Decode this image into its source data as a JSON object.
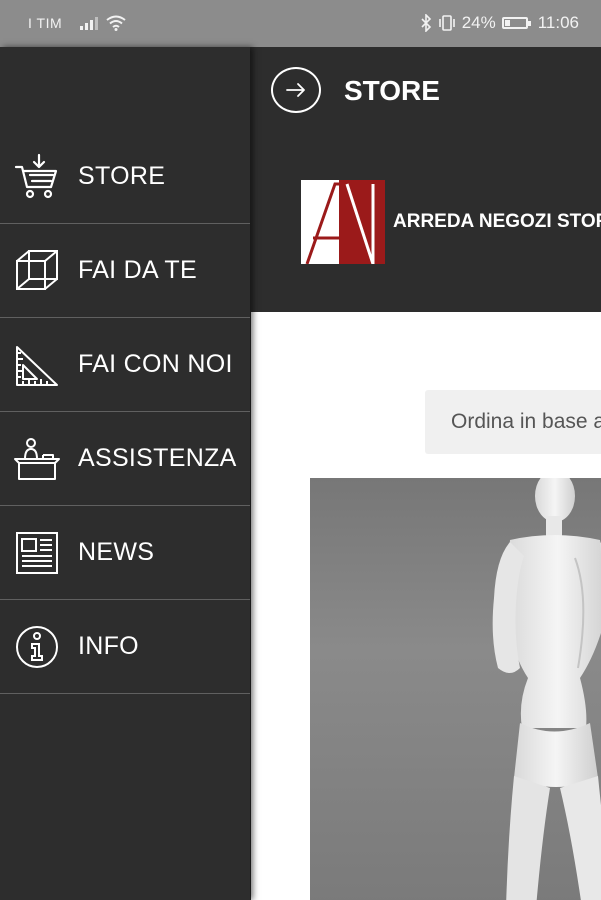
{
  "status_bar": {
    "carrier": "I TIM",
    "battery_percent": "24%",
    "battery_level": 0.24,
    "time": "11:06"
  },
  "drawer": {
    "items": [
      {
        "label": "STORE",
        "icon": "cart-download-icon"
      },
      {
        "label": "FAI DA TE",
        "icon": "cube-icon"
      },
      {
        "label": "FAI CON NOI",
        "icon": "set-square-icon"
      },
      {
        "label": "ASSISTENZA",
        "icon": "reception-desk-icon"
      },
      {
        "label": "NEWS",
        "icon": "newspaper-icon"
      },
      {
        "label": "INFO",
        "icon": "info-icon"
      }
    ]
  },
  "header": {
    "title": "STORE",
    "back_icon": "arrow-right-circle-icon"
  },
  "brand": {
    "name": "ARREDA NEGOZI STORE",
    "logo_colors": {
      "red": "#9b1a1a",
      "white": "#ffffff"
    }
  },
  "content": {
    "sort_label": "Ordina in base a"
  },
  "colors": {
    "background": "#2d2d2d",
    "status_bar": "#8c8c8c",
    "divider": "#606060",
    "content_bg": "#ffffff"
  }
}
